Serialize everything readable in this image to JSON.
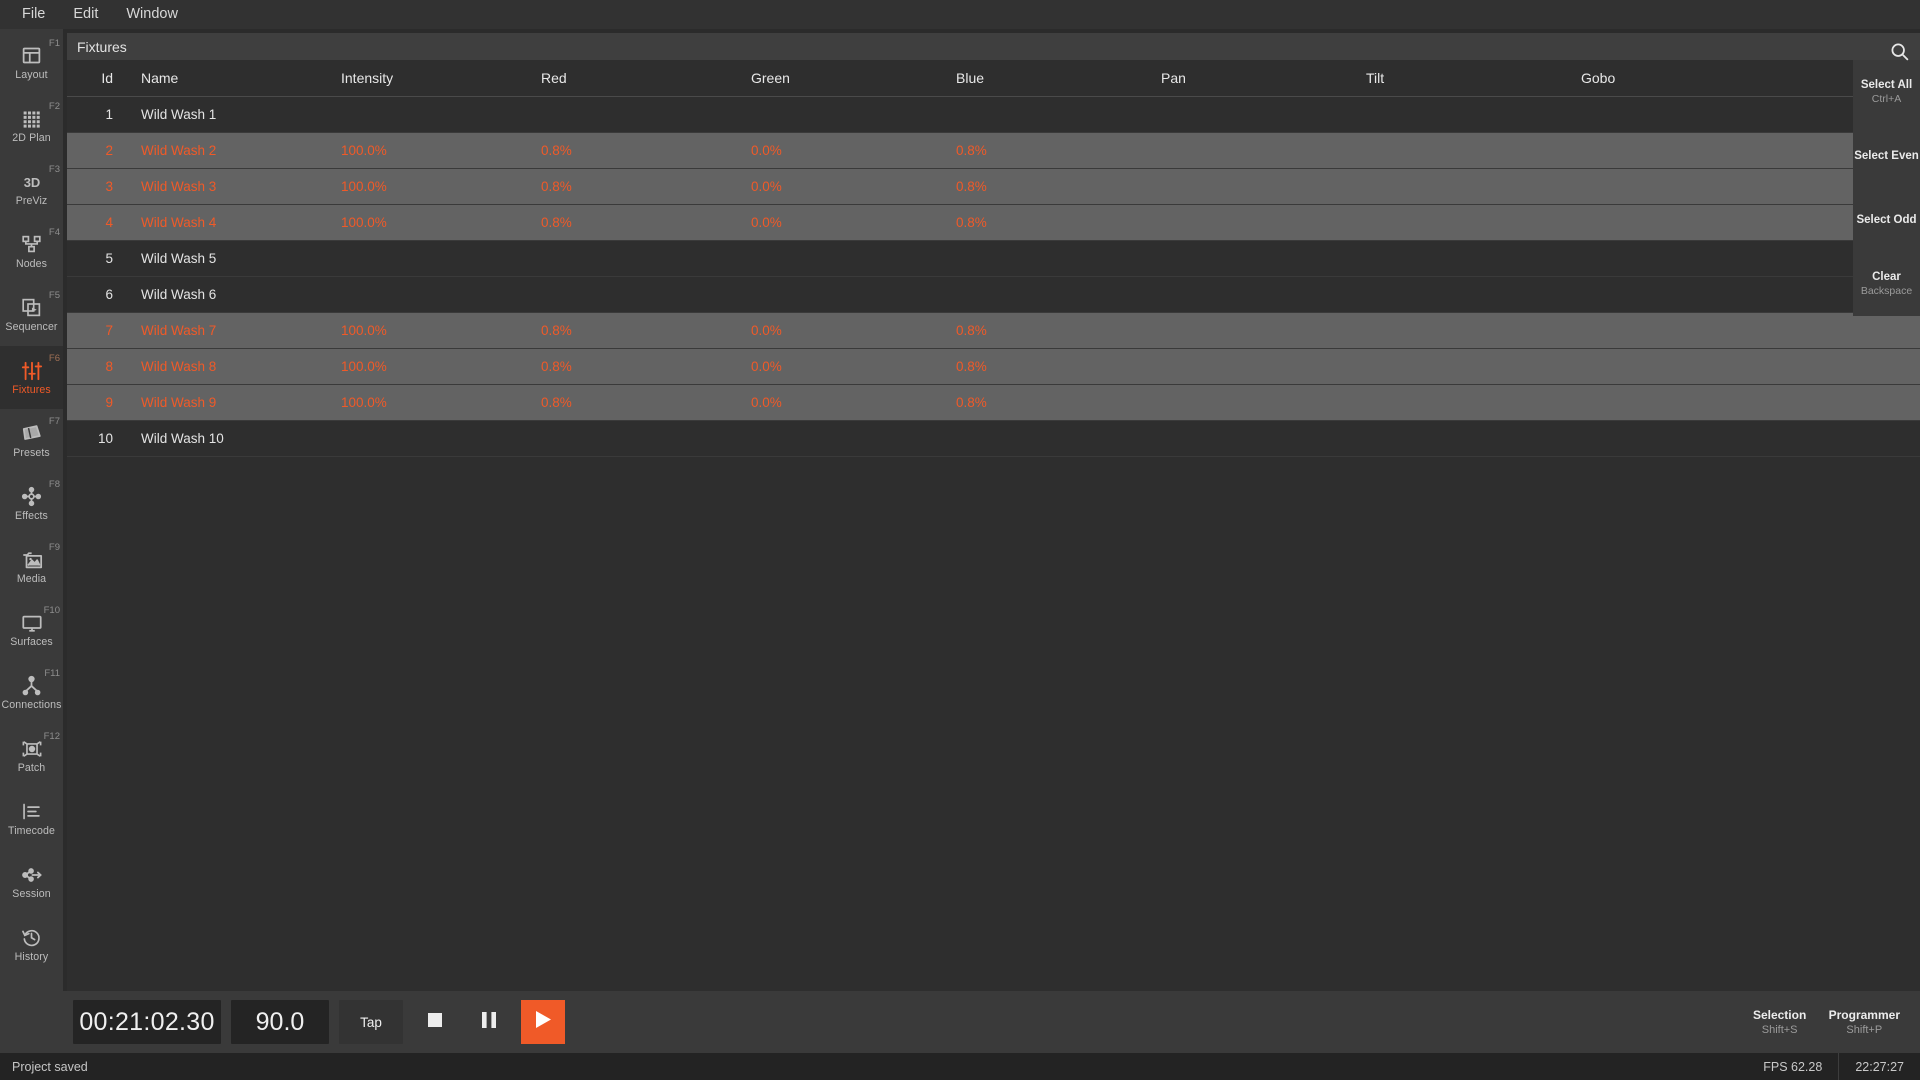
{
  "menubar": {
    "items": [
      {
        "label": "File"
      },
      {
        "label": "Edit"
      },
      {
        "label": "Window"
      }
    ]
  },
  "sidebar": {
    "items": [
      {
        "label": "Layout",
        "fkey": "F1",
        "icon": "layout-icon",
        "active": false
      },
      {
        "label": "2D Plan",
        "fkey": "F2",
        "icon": "grid-icon",
        "active": false
      },
      {
        "label": "PreViz",
        "fkey": "F3",
        "icon": "3d-icon",
        "active": false
      },
      {
        "label": "Nodes",
        "fkey": "F4",
        "icon": "nodes-icon",
        "active": false
      },
      {
        "label": "Sequencer",
        "fkey": "F5",
        "icon": "sequencer-icon",
        "active": false
      },
      {
        "label": "Fixtures",
        "fkey": "F6",
        "icon": "faders-icon",
        "active": true
      },
      {
        "label": "Presets",
        "fkey": "F7",
        "icon": "presets-icon",
        "active": false
      },
      {
        "label": "Effects",
        "fkey": "F8",
        "icon": "effects-icon",
        "active": false
      },
      {
        "label": "Media",
        "fkey": "F9",
        "icon": "media-icon",
        "active": false
      },
      {
        "label": "Surfaces",
        "fkey": "F10",
        "icon": "monitor-icon",
        "active": false
      },
      {
        "label": "Connections",
        "fkey": "F11",
        "icon": "connections-icon",
        "active": false
      },
      {
        "label": "Patch",
        "fkey": "F12",
        "icon": "patch-icon",
        "active": false
      },
      {
        "label": "Timecode",
        "fkey": "",
        "icon": "timecode-icon",
        "active": false
      },
      {
        "label": "Session",
        "fkey": "",
        "icon": "session-icon",
        "active": false
      },
      {
        "label": "History",
        "fkey": "",
        "icon": "history-icon",
        "active": false
      }
    ]
  },
  "panel": {
    "title": "Fixtures",
    "search_icon": "search-icon"
  },
  "table": {
    "columns": [
      "Id",
      "Name",
      "Intensity",
      "Red",
      "Green",
      "Blue",
      "Pan",
      "Tilt",
      "Gobo"
    ],
    "rows": [
      {
        "id": "1",
        "name": "Wild Wash 1",
        "intensity": "",
        "red": "",
        "green": "",
        "blue": "",
        "pan": "",
        "tilt": "",
        "gobo": "",
        "selected": false
      },
      {
        "id": "2",
        "name": "Wild Wash 2",
        "intensity": "100.0%",
        "red": "0.8%",
        "green": "0.0%",
        "blue": "0.8%",
        "pan": "",
        "tilt": "",
        "gobo": "",
        "selected": true
      },
      {
        "id": "3",
        "name": "Wild Wash 3",
        "intensity": "100.0%",
        "red": "0.8%",
        "green": "0.0%",
        "blue": "0.8%",
        "pan": "",
        "tilt": "",
        "gobo": "",
        "selected": true
      },
      {
        "id": "4",
        "name": "Wild Wash 4",
        "intensity": "100.0%",
        "red": "0.8%",
        "green": "0.0%",
        "blue": "0.8%",
        "pan": "",
        "tilt": "",
        "gobo": "",
        "selected": true
      },
      {
        "id": "5",
        "name": "Wild Wash 5",
        "intensity": "",
        "red": "",
        "green": "",
        "blue": "",
        "pan": "",
        "tilt": "",
        "gobo": "",
        "selected": false
      },
      {
        "id": "6",
        "name": "Wild Wash 6",
        "intensity": "",
        "red": "",
        "green": "",
        "blue": "",
        "pan": "",
        "tilt": "",
        "gobo": "",
        "selected": false
      },
      {
        "id": "7",
        "name": "Wild Wash 7",
        "intensity": "100.0%",
        "red": "0.8%",
        "green": "0.0%",
        "blue": "0.8%",
        "pan": "",
        "tilt": "",
        "gobo": "",
        "selected": true
      },
      {
        "id": "8",
        "name": "Wild Wash 8",
        "intensity": "100.0%",
        "red": "0.8%",
        "green": "0.0%",
        "blue": "0.8%",
        "pan": "",
        "tilt": "",
        "gobo": "",
        "selected": true
      },
      {
        "id": "9",
        "name": "Wild Wash 9",
        "intensity": "100.0%",
        "red": "0.8%",
        "green": "0.0%",
        "blue": "0.8%",
        "pan": "",
        "tilt": "",
        "gobo": "",
        "selected": true
      },
      {
        "id": "10",
        "name": "Wild Wash 10",
        "intensity": "",
        "red": "",
        "green": "",
        "blue": "",
        "pan": "",
        "tilt": "",
        "gobo": "",
        "selected": false
      }
    ]
  },
  "right_rail": {
    "buttons": [
      {
        "label": "Select All",
        "shortcut": "Ctrl+A"
      },
      {
        "label": "Select Even",
        "shortcut": ""
      },
      {
        "label": "Select Odd",
        "shortcut": ""
      },
      {
        "label": "Clear",
        "shortcut": "Backspace"
      }
    ]
  },
  "transport": {
    "timecode": "00:21:02.30",
    "bpm": "90.0",
    "tap_label": "Tap",
    "stop_icon": "stop-icon",
    "pause_icon": "pause-icon",
    "play_icon": "play-icon",
    "right_buttons": [
      {
        "label": "Selection",
        "shortcut": "Shift+S"
      },
      {
        "label": "Programmer",
        "shortcut": "Shift+P"
      }
    ]
  },
  "statusbar": {
    "message": "Project saved",
    "fps": "FPS 62.28",
    "clock": "22:27:27"
  },
  "colors": {
    "accent": "#f05a28",
    "panel_bg": "#2e2e2e",
    "sidebar_bg": "#3a3a3a",
    "row_selected_bg": "#636363",
    "status_bg": "#232323"
  }
}
